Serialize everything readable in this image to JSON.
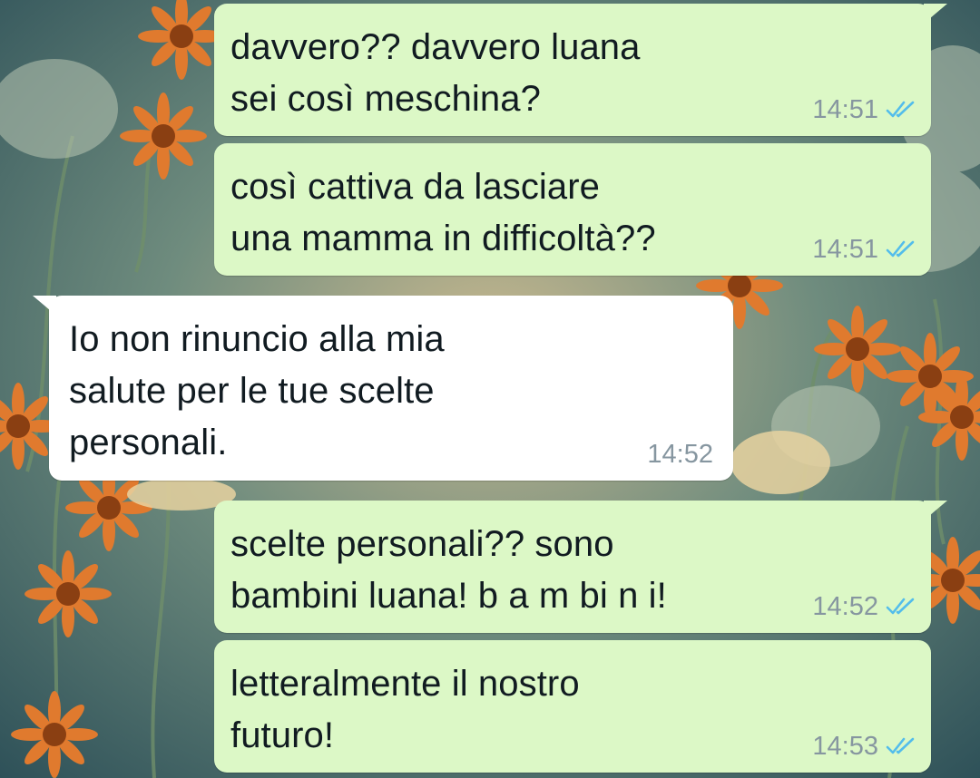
{
  "colors": {
    "outgoing_bubble": "#dcf8c6",
    "incoming_bubble": "#ffffff",
    "text": "#111b21",
    "timestamp": "#8696a0",
    "read_ticks": "#53bdeb"
  },
  "messages": [
    {
      "direction": "outgoing",
      "text": "davvero?? davvero luana\nsei così meschina?",
      "time": "14:51",
      "status_icon": "double-check-read-icon"
    },
    {
      "direction": "outgoing",
      "text": "così cattiva da lasciare\nuna mamma in difficoltà??",
      "time": "14:51",
      "status_icon": "double-check-read-icon"
    },
    {
      "direction": "incoming",
      "text": "Io non rinuncio alla mia\nsalute per le tue scelte\npersonali.",
      "time": "14:52"
    },
    {
      "direction": "outgoing",
      "text": "scelte personali?? sono\nbambini luana! b a m bi n i!",
      "time": "14:52",
      "status_icon": "double-check-read-icon"
    },
    {
      "direction": "outgoing",
      "text": "letteralmente il nostro\nfuturo!",
      "time": "14:53",
      "status_icon": "double-check-read-icon"
    }
  ]
}
